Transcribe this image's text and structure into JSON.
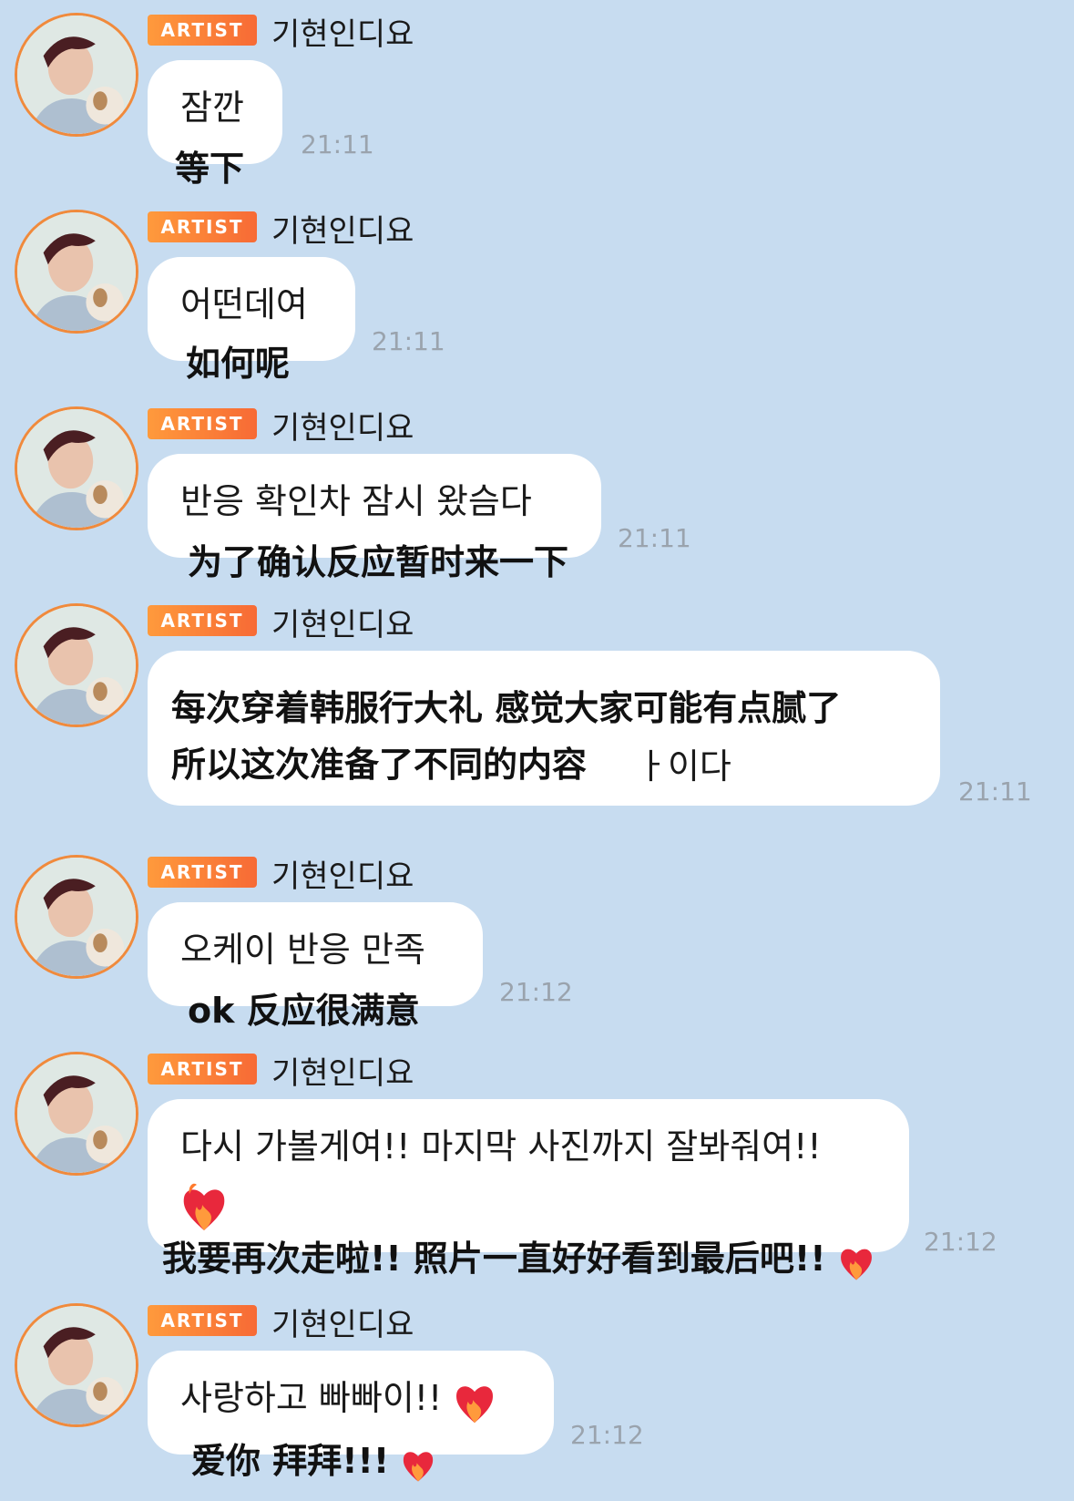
{
  "artist_badge": "ARTIST",
  "sender_name": "기현인디요",
  "messages": [
    {
      "text": "잠깐",
      "translation": "等下",
      "time": "21:11"
    },
    {
      "text": "어떤데여",
      "translation": "如何呢",
      "time": "21:11"
    },
    {
      "text": "반응 확인차 잠시 왔슴다",
      "translation": "为了确认反应暂时来一下",
      "time": "21:11"
    },
    {
      "text": "ㅏ이다",
      "translation_line1": "每次穿着韩服行大礼 感觉大家可能有点腻了",
      "translation_line2": "所以这次准备了不同的内容",
      "time": "21:11"
    },
    {
      "text": "오케이 반응 만족",
      "translation": "ok 反应很满意",
      "time": "21:12"
    },
    {
      "text": "다시 가볼게여!! 마지막 사진까지 잘봐줘여!!",
      "translation": "我要再次走啦!! 照片一直好好看到最后吧!!",
      "time": "21:12"
    },
    {
      "text": "사랑하고 빠빠이!!",
      "translation": "爱你 拜拜!!!",
      "time": "21:12"
    }
  ],
  "colors": {
    "background": "#c7dcf0",
    "badge": "#f76a35",
    "avatar_ring": "#f08a3c",
    "time": "#9aa3ad"
  },
  "icons": [
    "avatar-photo",
    "heart-fire-icon"
  ]
}
